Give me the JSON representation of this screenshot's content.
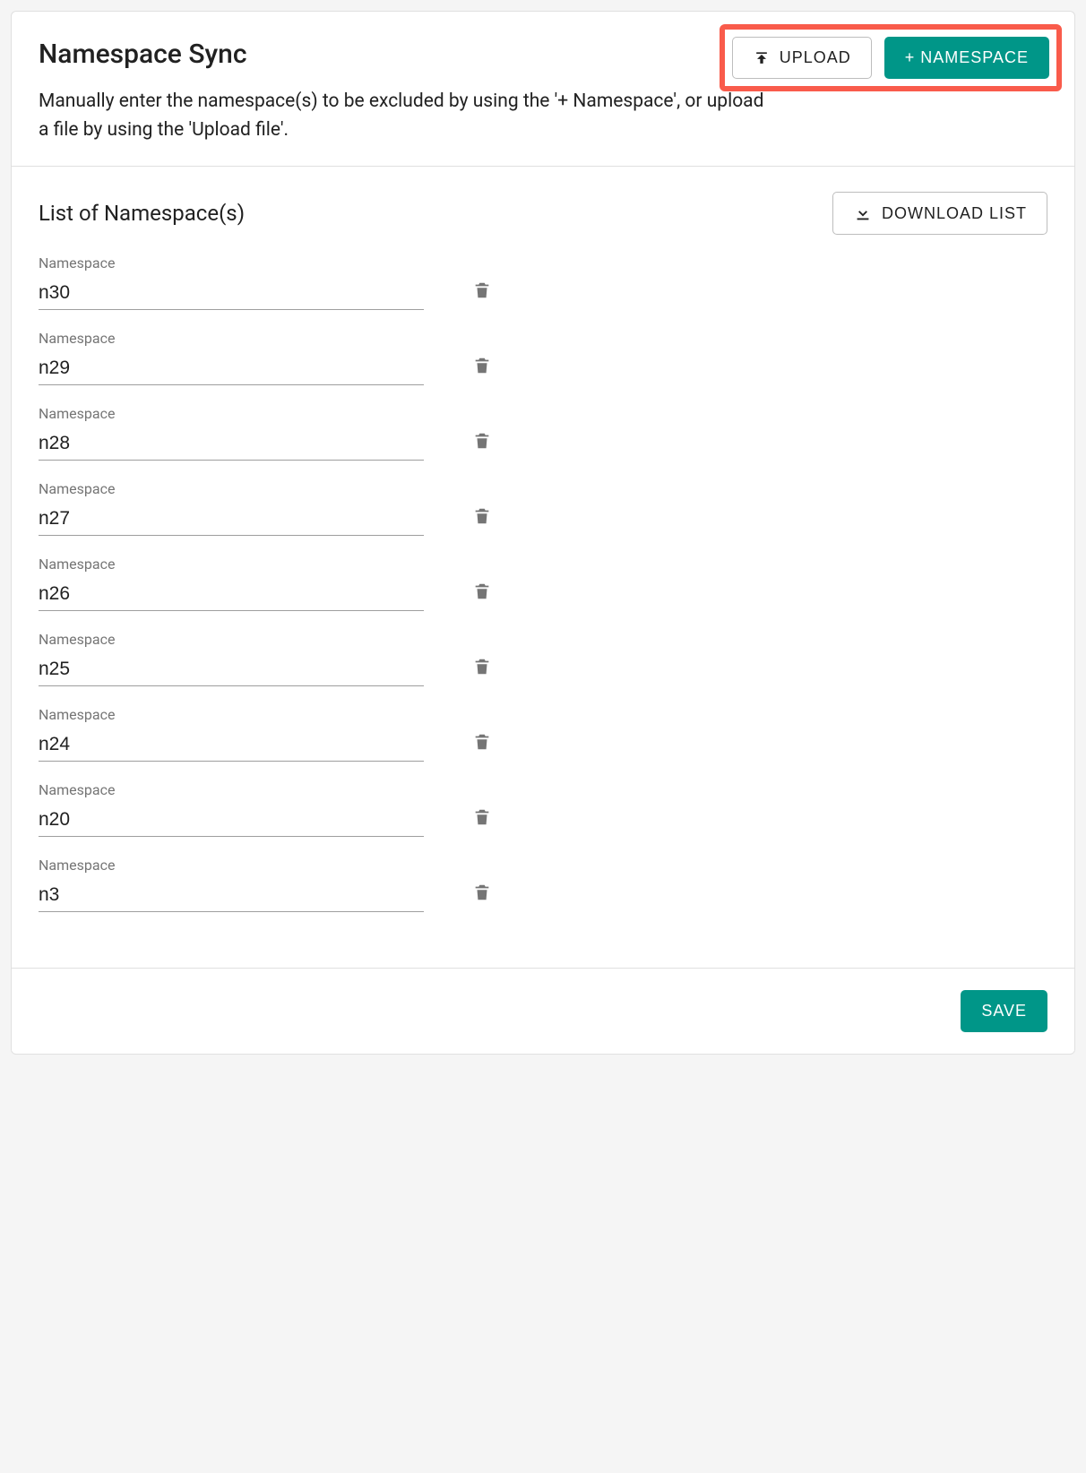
{
  "header": {
    "title": "Namespace Sync",
    "upload_label": "UPLOAD",
    "add_namespace_label": "+ NAMESPACE",
    "description": "Manually enter the namespace(s) to be excluded by using the '+ Namespace', or upload a file by using the 'Upload file'."
  },
  "list": {
    "title": "List of Namespace(s)",
    "download_label": "DOWNLOAD LIST",
    "field_label": "Namespace",
    "items": [
      {
        "value": "n30"
      },
      {
        "value": "n29"
      },
      {
        "value": "n28"
      },
      {
        "value": "n27"
      },
      {
        "value": "n26"
      },
      {
        "value": "n25"
      },
      {
        "value": "n24"
      },
      {
        "value": "n20"
      },
      {
        "value": "n3"
      }
    ]
  },
  "footer": {
    "save_label": "SAVE"
  }
}
